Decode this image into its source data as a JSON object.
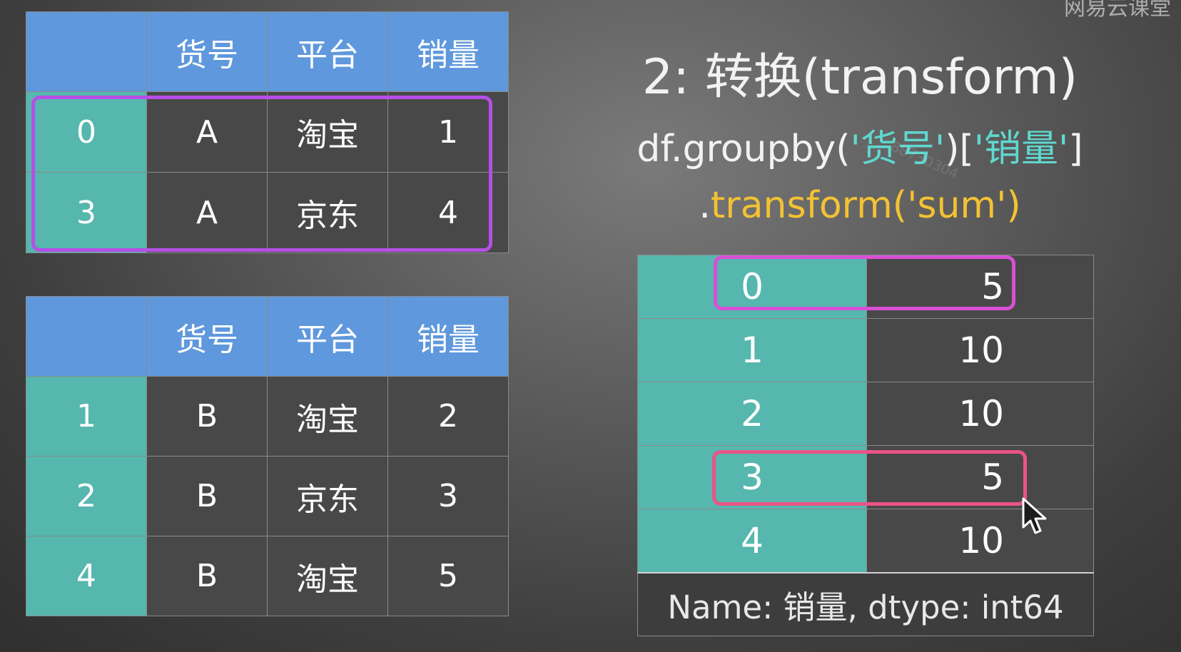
{
  "brand": "网易云课堂",
  "watermark": "88730304",
  "colors": {
    "header_blue": "#5f98dc",
    "index_teal": "#55b7ad",
    "cell_dark": "#484848",
    "highlight_purple": "#b64fe6",
    "highlight_magenta": "#d94fd6",
    "highlight_pink": "#ea5487",
    "code_string_cyan": "#5fd8cf",
    "code_string_yellow": "#f3c233"
  },
  "group_a": {
    "headers": [
      "",
      "货号",
      "平台",
      "销量"
    ],
    "rows": [
      [
        "0",
        "A",
        "淘宝",
        "1"
      ],
      [
        "3",
        "A",
        "京东",
        "4"
      ]
    ]
  },
  "group_b": {
    "headers": [
      "",
      "货号",
      "平台",
      "销量"
    ],
    "rows": [
      [
        "1",
        "B",
        "淘宝",
        "2"
      ],
      [
        "2",
        "B",
        "京东",
        "3"
      ],
      [
        "4",
        "B",
        "淘宝",
        "5"
      ]
    ]
  },
  "title": "2: 转换(transform)",
  "code": {
    "line1_prefix": "df.groupby(",
    "line1_arg1": "'货号'",
    "line1_mid": ")[",
    "line1_arg2": "'销量'",
    "line1_suffix": "]",
    "line2_prefix": ".",
    "line2_method": "transform('sum')"
  },
  "result": {
    "rows": [
      {
        "index": "0",
        "value": "5"
      },
      {
        "index": "1",
        "value": "10"
      },
      {
        "index": "2",
        "value": "10"
      },
      {
        "index": "3",
        "value": "5"
      },
      {
        "index": "4",
        "value": "10"
      }
    ],
    "footer": "Name: 销量, dtype: int64"
  }
}
